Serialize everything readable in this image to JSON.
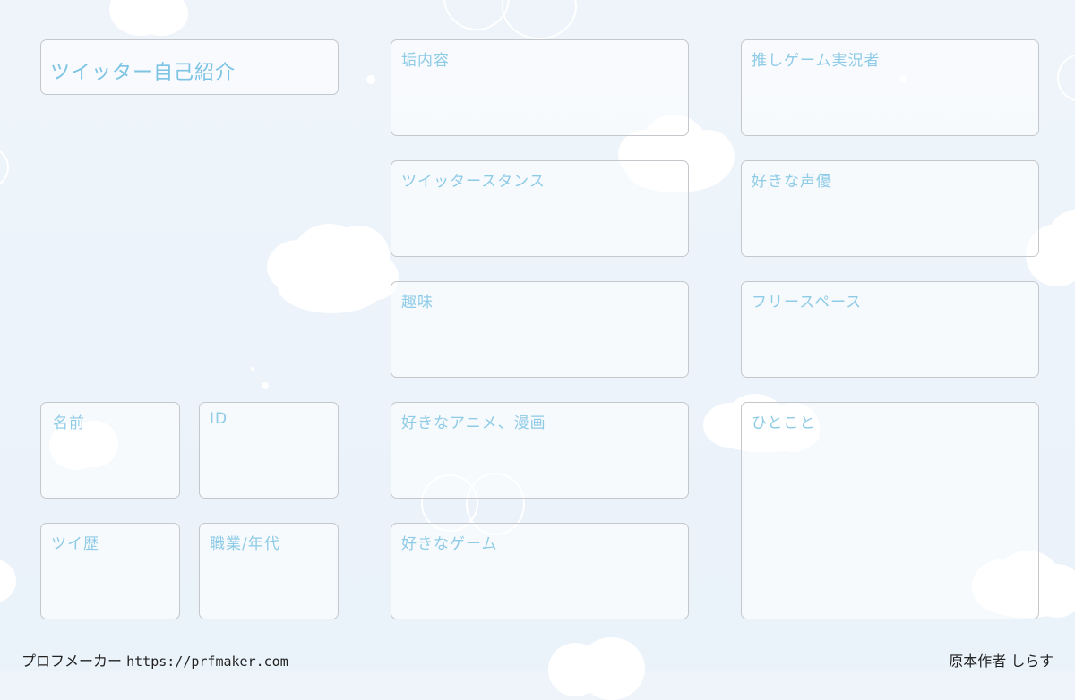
{
  "title": "ツイッター自己紹介",
  "fields": {
    "content": "垢内容",
    "stance": "ツイッタースタンス",
    "hobby": "趣味",
    "anime_manga": "好きなアニメ、漫画",
    "game": "好きなゲーム",
    "streamer": "推しゲーム実況者",
    "voice_actor": "好きな声優",
    "free_space": "フリースペース",
    "hitokoto": "ひとこと",
    "name": "名前",
    "id": "ID",
    "twitter_history": "ツイ歴",
    "job_age": "職業/年代"
  },
  "footer": {
    "maker_label": "プロフメーカー",
    "maker_url": "https://prfmaker.com",
    "author_label": "原本作者",
    "author_name": "しらす"
  },
  "colors": {
    "background": "#eef4fa",
    "label": "#8ecbe6",
    "card_border": "#c4c8cc",
    "footer_text": "#222222"
  }
}
